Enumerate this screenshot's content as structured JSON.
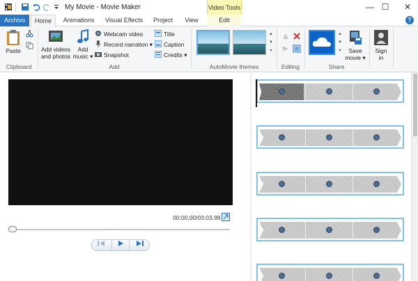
{
  "window": {
    "title": "My Movie - Movie Maker",
    "context_group": "Video Tools",
    "minimize": "—",
    "maximize": "☐",
    "close": "✕"
  },
  "tabs": {
    "file": "Archivo",
    "home": "Home",
    "animations": "Animations",
    "visual_effects": "Visual Effects",
    "project": "Project",
    "view": "View",
    "edit": "Edit",
    "help": "?"
  },
  "ribbon": {
    "clipboard": {
      "paste": "Paste",
      "label": "Clipboard"
    },
    "add": {
      "add_videos_l1": "Add videos",
      "add_videos_l2": "and photos",
      "add_music_l1": "Add",
      "add_music_l2": "music ▾",
      "webcam": "Webcam video",
      "record": "Record narration ▾",
      "snapshot": "Snapshot",
      "title": "Title",
      "caption": "Caption",
      "credits": "Credits ▾",
      "label": "Add"
    },
    "themes": {
      "label": "AutoMovie themes"
    },
    "editing": {
      "label": "Editing"
    },
    "share": {
      "save_l1": "Save",
      "save_l2": "movie ▾",
      "label": "Share"
    },
    "signin": {
      "l1": "Sign",
      "l2": "in"
    }
  },
  "player": {
    "timecode": "00:00,00/03:03,99",
    "progress": 0
  },
  "colors": {
    "file_tab": "#2b74c2",
    "context_tab": "#fbf6b6",
    "clip_border": "#7ec2e4",
    "preview_bg": "#111111"
  }
}
